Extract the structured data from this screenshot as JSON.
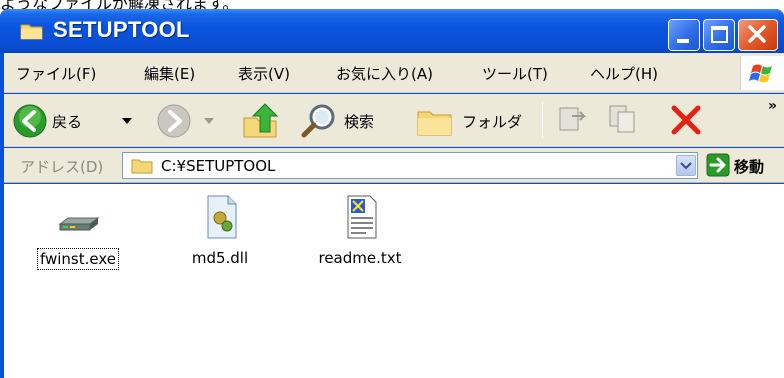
{
  "caption": "ようなファイルが解凍されます。",
  "window": {
    "title": "SETUPTOOL",
    "controls": {
      "minimize": "minimize",
      "maximize": "maximize",
      "close": "close"
    }
  },
  "menu": {
    "file": "ファイル(F)",
    "edit": "編集(E)",
    "view": "表示(V)",
    "favorites": "お気に入り(A)",
    "tools": "ツール(T)",
    "help": "ヘルプ(H)"
  },
  "toolbar": {
    "back": "戻る",
    "search": "検索",
    "folders": "フォルダ",
    "more": "»"
  },
  "address": {
    "label": "アドレス(D)",
    "value": "C:¥SETUPTOOL",
    "go": "移動"
  },
  "files": [
    {
      "name": "fwinst.exe",
      "type": "exe",
      "focused": true
    },
    {
      "name": "md5.dll",
      "type": "dll",
      "focused": false
    },
    {
      "name": "readme.txt",
      "type": "txt",
      "focused": false
    }
  ],
  "colors": {
    "titlebar": "#0a4fd8",
    "chrome": "#ece9d8",
    "close_button": "#e35a2a",
    "delete_red": "#e8200c",
    "nav_green": "#2a9a2a"
  }
}
